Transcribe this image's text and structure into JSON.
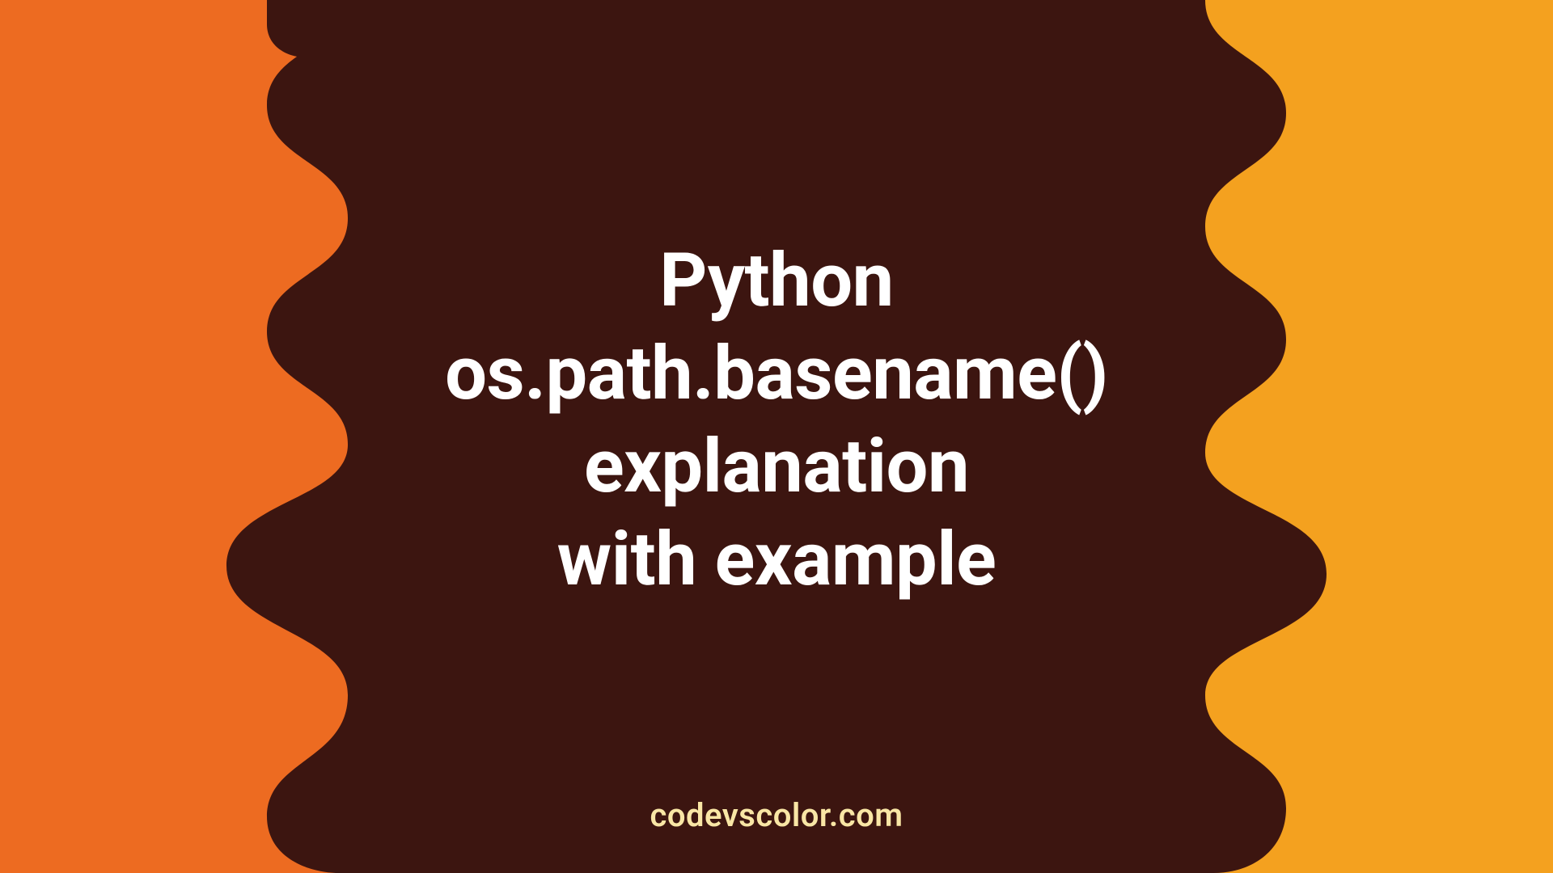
{
  "colors": {
    "orange_left": "#ED6B21",
    "orange_right": "#F4A11F",
    "blob": "#3C1510",
    "title": "#FFFFFF",
    "watermark": "#F9E6A5"
  },
  "title_lines": [
    "Python",
    "os.path.basename()",
    "explanation",
    "with example"
  ],
  "watermark": "codevscolor.com"
}
